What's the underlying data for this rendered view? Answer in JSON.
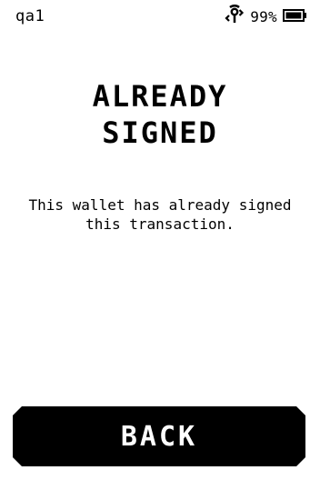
{
  "status_bar": {
    "device_name": "qa1",
    "battery_percent_label": "99%",
    "battery_level": 0.99,
    "icons": [
      "usb-icon",
      "battery-icon"
    ]
  },
  "main": {
    "title_line1": "ALREADY",
    "title_line2": "SIGNED",
    "message_line1": "This wallet has already signed",
    "message_line2": "this transaction."
  },
  "actions": {
    "back_label": "BACK"
  },
  "colors": {
    "background": "#ffffff",
    "foreground": "#000000",
    "button_text": "#ffffff"
  }
}
